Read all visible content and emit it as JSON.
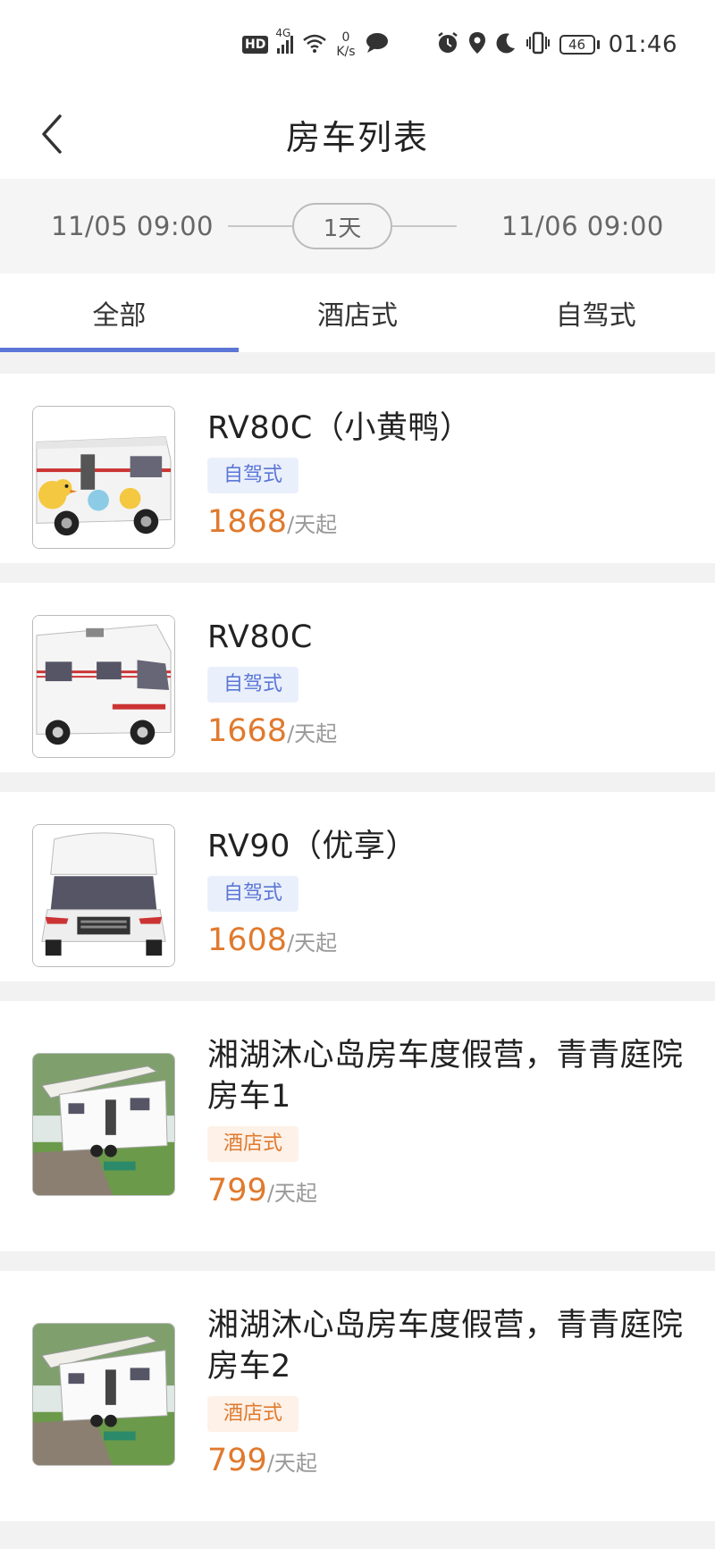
{
  "status_bar": {
    "hd": "HD",
    "network": "4G",
    "speed_value": "0",
    "speed_unit": "K/s",
    "battery": "46",
    "time": "01:46"
  },
  "header": {
    "title": "房车列表"
  },
  "date_bar": {
    "start": "11/05 09:00",
    "days": "1天",
    "end": "11/06 09:00"
  },
  "tabs": [
    {
      "label": "全部",
      "active": true
    },
    {
      "label": "酒店式",
      "active": false
    },
    {
      "label": "自驾式",
      "active": false
    }
  ],
  "price_unit": "/天起",
  "items": [
    {
      "name": "RV80C（小黄鸭）",
      "tag": "自驾式",
      "price": "1868"
    },
    {
      "name": "RV80C",
      "tag": "自驾式",
      "price": "1668"
    },
    {
      "name": "RV90（优享）",
      "tag": "自驾式",
      "price": "1608"
    },
    {
      "name": "湘湖沐心岛房车度假营，青青庭院房车1",
      "tag": "酒店式",
      "price": "799"
    },
    {
      "name": "湘湖沐心岛房车度假营，青青庭院房车2",
      "tag": "酒店式",
      "price": "799"
    }
  ]
}
